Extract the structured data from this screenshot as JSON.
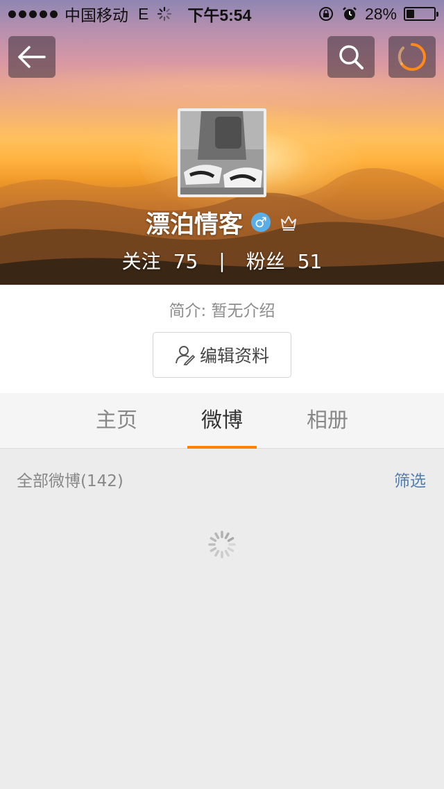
{
  "status_bar": {
    "carrier": "中国移动",
    "network": "E",
    "time": "下午5:54",
    "battery": "28%",
    "battery_level": 0.28
  },
  "header": {
    "back_icon": "arrow-left-icon",
    "search_icon": "search-icon",
    "refresh_icon": "refresh-progress-icon"
  },
  "profile": {
    "username": "漂泊情客",
    "gender_badge": "♂",
    "follow_label": "关注",
    "follow_count": "75",
    "divider": "|",
    "fans_label": "粉丝",
    "fans_count": "51",
    "intro": "简介: 暂无介绍",
    "edit_label": "编辑资料"
  },
  "tabs": [
    {
      "label": "主页",
      "active": false
    },
    {
      "label": "微博",
      "active": true
    },
    {
      "label": "相册",
      "active": false
    }
  ],
  "list": {
    "all_label": "全部微博(142)",
    "filter_label": "筛选"
  },
  "colors": {
    "accent": "#ff8200",
    "link": "#507daf",
    "male_badge": "#5aaee8"
  }
}
